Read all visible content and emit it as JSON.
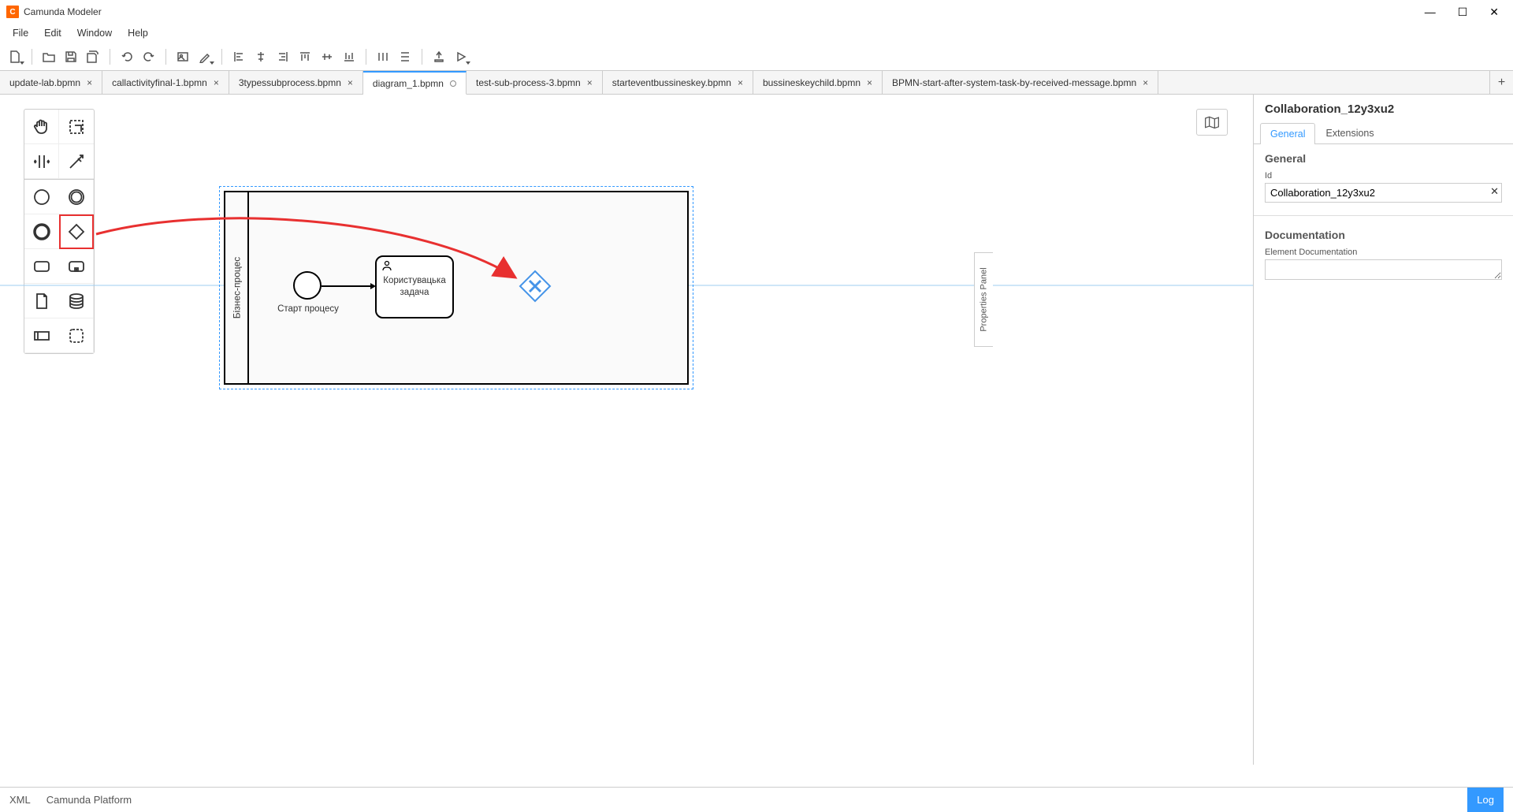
{
  "app": {
    "title": "Camunda Modeler",
    "icon_initial": "C"
  },
  "menu": [
    "File",
    "Edit",
    "Window",
    "Help"
  ],
  "tabs": [
    {
      "label": "update-lab.bpmn",
      "active": false,
      "dirty": false
    },
    {
      "label": "callactivityfinal-1.bpmn",
      "active": false,
      "dirty": false
    },
    {
      "label": "3typessubprocess.bpmn",
      "active": false,
      "dirty": false
    },
    {
      "label": "diagram_1.bpmn",
      "active": true,
      "dirty": true
    },
    {
      "label": "test-sub-process-3.bpmn",
      "active": false,
      "dirty": false
    },
    {
      "label": "starteventbussineskey.bpmn",
      "active": false,
      "dirty": false
    },
    {
      "label": "bussineskeychild.bpmn",
      "active": false,
      "dirty": false
    },
    {
      "label": "BPMN-start-after-system-task-by-received-message.bpmn",
      "active": false,
      "dirty": false
    }
  ],
  "diagram": {
    "pool_name": "Бізнес-процес",
    "start_event_label": "Старт процесу",
    "user_task_label": "Користувацька задача"
  },
  "properties": {
    "title": "Collaboration_12y3xu2",
    "tabs": {
      "general": "General",
      "extensions": "Extensions"
    },
    "section_general": "General",
    "id_label": "Id",
    "id_value": "Collaboration_12y3xu2",
    "section_documentation": "Documentation",
    "doc_label": "Element Documentation",
    "doc_value": "",
    "panel_toggle_label": "Properties Panel"
  },
  "statusbar": {
    "xml": "XML",
    "platform": "Camunda Platform",
    "log": "Log"
  }
}
